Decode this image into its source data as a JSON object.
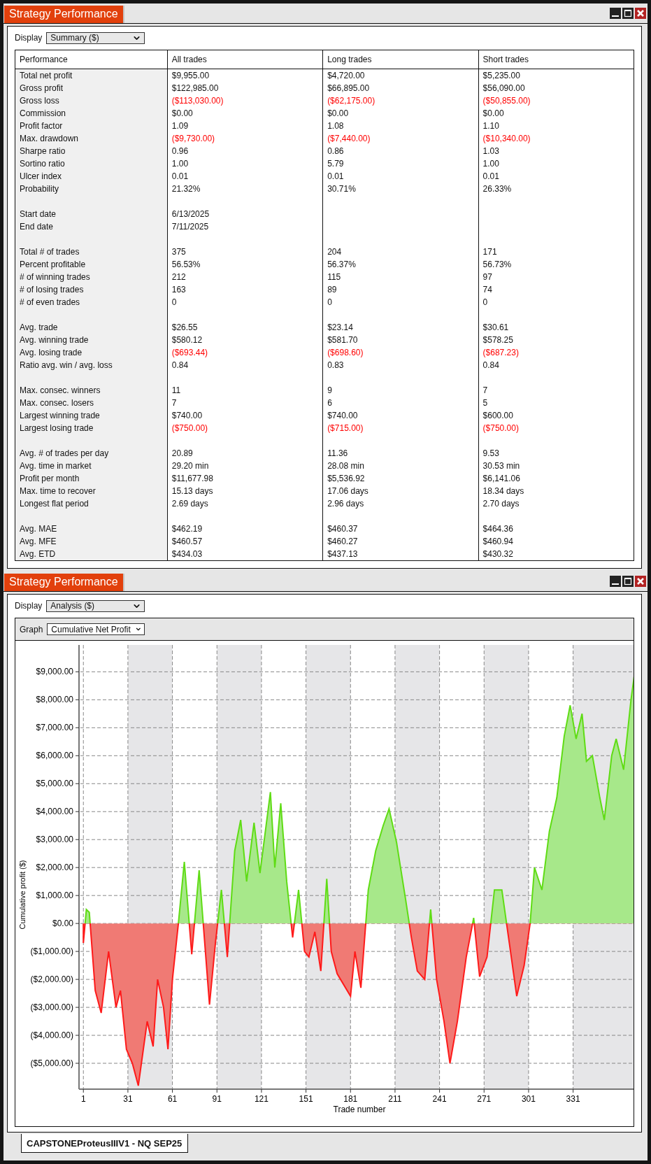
{
  "panels": [
    {
      "kind": "summary",
      "title": "Strategy Performance",
      "display": {
        "label": "Display",
        "value": "Summary ($)"
      },
      "table": {
        "columns": [
          "Performance",
          "All trades",
          "Long trades",
          "Short trades"
        ],
        "groups": [
          {
            "rows": [
              {
                "label": "Total net profit",
                "values": [
                  "$9,955.00",
                  "$4,720.00",
                  "$5,235.00"
                ],
                "negative": false
              },
              {
                "label": "Gross profit",
                "values": [
                  "$122,985.00",
                  "$66,895.00",
                  "$56,090.00"
                ],
                "negative": false
              },
              {
                "label": "Gross loss",
                "values": [
                  "($113,030.00)",
                  "($62,175.00)",
                  "($50,855.00)"
                ],
                "negative": true
              },
              {
                "label": "Commission",
                "values": [
                  "$0.00",
                  "$0.00",
                  "$0.00"
                ],
                "negative": false
              },
              {
                "label": "Profit factor",
                "values": [
                  "1.09",
                  "1.08",
                  "1.10"
                ],
                "negative": false
              },
              {
                "label": "Max. drawdown",
                "values": [
                  "($9,730.00)",
                  "($7,440.00)",
                  "($10,340.00)"
                ],
                "negative": true
              },
              {
                "label": "Sharpe ratio",
                "values": [
                  "0.96",
                  "0.86",
                  "1.03"
                ],
                "negative": false
              },
              {
                "label": "Sortino ratio",
                "values": [
                  "1.00",
                  "5.79",
                  "1.00"
                ],
                "negative": false
              },
              {
                "label": "Ulcer index",
                "values": [
                  "0.01",
                  "0.01",
                  "0.01"
                ],
                "negative": false
              },
              {
                "label": "Probability",
                "values": [
                  "21.32%",
                  "30.71%",
                  "26.33%"
                ],
                "negative": false
              }
            ]
          },
          {
            "rows": [
              {
                "label": "Start date",
                "values": [
                  "6/13/2025"
                ],
                "negative": false
              },
              {
                "label": "End date",
                "values": [
                  "7/11/2025"
                ],
                "negative": false
              }
            ]
          },
          {
            "rows": [
              {
                "label": "Total # of trades",
                "values": [
                  "375",
                  "204",
                  "171"
                ],
                "negative": false
              },
              {
                "label": "Percent profitable",
                "values": [
                  "56.53%",
                  "56.37%",
                  "56.73%"
                ],
                "negative": false
              },
              {
                "label": "# of winning trades",
                "values": [
                  "212",
                  "115",
                  "97"
                ],
                "negative": false
              },
              {
                "label": "# of losing trades",
                "values": [
                  "163",
                  "89",
                  "74"
                ],
                "negative": false
              },
              {
                "label": "# of even trades",
                "values": [
                  "0",
                  "0",
                  "0"
                ],
                "negative": false
              }
            ]
          },
          {
            "rows": [
              {
                "label": "Avg. trade",
                "values": [
                  "$26.55",
                  "$23.14",
                  "$30.61"
                ],
                "negative": false
              },
              {
                "label": "Avg. winning trade",
                "values": [
                  "$580.12",
                  "$581.70",
                  "$578.25"
                ],
                "negative": false
              },
              {
                "label": "Avg. losing trade",
                "values": [
                  "($693.44)",
                  "($698.60)",
                  "($687.23)"
                ],
                "negative": true
              },
              {
                "label": "Ratio avg. win / avg. loss",
                "values": [
                  "0.84",
                  "0.83",
                  "0.84"
                ],
                "negative": false
              }
            ]
          },
          {
            "rows": [
              {
                "label": "Max. consec. winners",
                "values": [
                  "11",
                  "9",
                  "7"
                ],
                "negative": false
              },
              {
                "label": "Max. consec. losers",
                "values": [
                  "7",
                  "6",
                  "5"
                ],
                "negative": false
              },
              {
                "label": "Largest winning trade",
                "values": [
                  "$740.00",
                  "$740.00",
                  "$600.00"
                ],
                "negative": false
              },
              {
                "label": "Largest losing trade",
                "values": [
                  "($750.00)",
                  "($715.00)",
                  "($750.00)"
                ],
                "negative": true
              }
            ]
          },
          {
            "rows": [
              {
                "label": "Avg. # of trades per day",
                "values": [
                  "20.89",
                  "11.36",
                  "9.53"
                ],
                "negative": false
              },
              {
                "label": "Avg. time in market",
                "values": [
                  "29.20 min",
                  "28.08 min",
                  "30.53 min"
                ],
                "negative": false
              },
              {
                "label": "Profit per month",
                "values": [
                  "$11,677.98",
                  "$5,536.92",
                  "$6,141.06"
                ],
                "negative": false
              },
              {
                "label": "Max. time to recover",
                "values": [
                  "15.13 days",
                  "17.06 days",
                  "18.34 days"
                ],
                "negative": false
              },
              {
                "label": "Longest flat period",
                "values": [
                  "2.69 days",
                  "2.96 days",
                  "2.70 days"
                ],
                "negative": false
              }
            ]
          },
          {
            "rows": [
              {
                "label": "Avg. MAE",
                "values": [
                  "$462.19",
                  "$460.37",
                  "$464.36"
                ],
                "negative": false
              },
              {
                "label": "Avg. MFE",
                "values": [
                  "$460.57",
                  "$460.27",
                  "$460.94"
                ],
                "negative": false
              },
              {
                "label": "Avg. ETD",
                "values": [
                  "$434.03",
                  "$437.13",
                  "$430.32"
                ],
                "negative": false
              }
            ]
          }
        ]
      }
    },
    {
      "kind": "analysis",
      "title": "Strategy Performance",
      "display": {
        "label": "Display",
        "value": "Analysis ($)"
      },
      "graph": {
        "label": "Graph",
        "value": "Cumulative Net Profit",
        "chart_data": {
          "type": "area",
          "xlabel": "Trade number",
          "ylabel": "Cumulative profit ($)",
          "x": [
            1,
            3,
            5,
            9,
            13,
            18,
            23,
            26,
            30,
            34,
            38,
            44,
            48,
            51,
            55,
            58,
            61,
            65,
            69,
            74,
            79,
            86,
            90,
            94,
            98,
            103,
            107,
            111,
            116,
            120,
            127,
            130,
            134,
            138,
            142,
            146,
            150,
            153,
            157,
            161,
            165,
            168,
            172,
            181,
            184,
            188,
            193,
            198,
            203,
            207,
            212,
            218,
            222,
            226,
            231,
            235,
            239,
            244,
            248,
            253,
            259,
            264,
            268,
            273,
            278,
            283,
            288,
            293,
            298,
            302,
            305,
            310,
            315,
            320,
            325,
            329,
            333,
            337,
            340,
            344,
            349,
            352,
            357,
            360,
            365,
            370,
            375
          ],
          "grid": true,
          "series": [
            {
              "values": [
                -700,
                500,
                400,
                -2400,
                -3200,
                -1000,
                -3000,
                -2400,
                -4500,
                -5000,
                -5800,
                -3500,
                -4400,
                -2000,
                -3000,
                -4500,
                -2000,
                0,
                2200,
                -1100,
                1900,
                -2900,
                -700,
                1200,
                -1200,
                2600,
                3700,
                1500,
                3600,
                1800,
                4700,
                2000,
                4300,
                1500,
                -500,
                1200,
                -1000,
                -1200,
                -300,
                -1700,
                1600,
                -1000,
                -1800,
                -2600,
                -1000,
                -2300,
                1200,
                2600,
                3500,
                4100,
                2900,
                900,
                -500,
                -1700,
                -2000,
                500,
                -2000,
                -3500,
                -5000,
                -3500,
                -1200,
                200,
                -1900,
                -1200,
                1200,
                1200,
                -700,
                -2600,
                -1500,
                0,
                2000,
                1200,
                3300,
                4500,
                6700,
                7800,
                6600,
                7500,
                5800,
                6000,
                4500,
                3700,
                6000,
                6600,
                5500,
                8000,
                9950
              ]
            }
          ],
          "xlim": [
            -1,
            375
          ],
          "ylim": [
            -5900,
            9960
          ],
          "xticks": [
            1,
            31,
            61,
            91,
            121,
            151,
            181,
            211,
            241,
            271,
            301,
            331
          ],
          "yticks": [
            {
              "value": -5000,
              "label": "($5,000.00)"
            },
            {
              "value": -4000,
              "label": "($4,000.00)"
            },
            {
              "value": -3000,
              "label": "($3,000.00)"
            },
            {
              "value": -2000,
              "label": "($2,000.00)"
            },
            {
              "value": -1000,
              "label": "($1,000.00)"
            },
            {
              "value": 0,
              "label": "$0.00"
            },
            {
              "value": 1000,
              "label": "$1,000.00"
            },
            {
              "value": 2000,
              "label": "$2,000.00"
            },
            {
              "value": 3000,
              "label": "$3,000.00"
            },
            {
              "value": 4000,
              "label": "$4,000.00"
            },
            {
              "value": 5000,
              "label": "$5,000.00"
            },
            {
              "value": 6000,
              "label": "$6,000.00"
            },
            {
              "value": 7000,
              "label": "$7,000.00"
            },
            {
              "value": 8000,
              "label": "$8,000.00"
            },
            {
              "value": 9000,
              "label": "$9,000.00"
            }
          ]
        }
      }
    }
  ],
  "tabs": [
    {
      "label": "CAPSTONEProteusIIIV1 - NQ SEP25",
      "selected": true
    }
  ]
}
